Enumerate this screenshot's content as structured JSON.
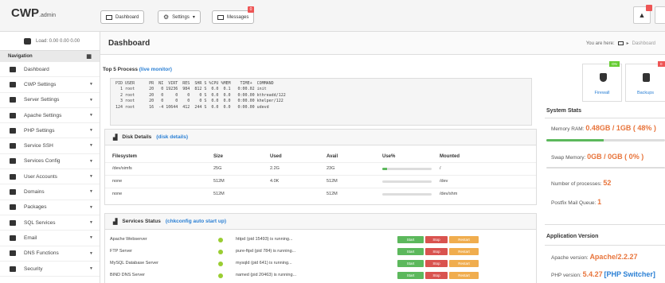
{
  "topbar": {
    "brand": "CWP",
    "brand_suffix": ".admin",
    "dashboard_btn": "Dashboard",
    "settings_btn": "Settings",
    "messages_btn": "Messages",
    "messages_badge": "0"
  },
  "sidebar": {
    "load": "Load: 0.00 0.00 0.00",
    "nav_title": "Navigation",
    "items": [
      {
        "label": "Dashboard",
        "icon": "home-icon",
        "arrow": ""
      },
      {
        "label": "CWP Settings",
        "icon": "wrench-icon",
        "arrow": "▼"
      },
      {
        "label": "Server Settings",
        "icon": "server-icon",
        "arrow": "▼"
      },
      {
        "label": "Apache Settings",
        "icon": "feather-icon",
        "arrow": "▼"
      },
      {
        "label": "PHP Settings",
        "icon": "gear-icon",
        "arrow": "▼"
      },
      {
        "label": "Service SSH",
        "icon": "monitor-icon",
        "arrow": "▼"
      },
      {
        "label": "Services Config",
        "icon": "list-icon",
        "arrow": "▼"
      },
      {
        "label": "User Accounts",
        "icon": "user-icon",
        "arrow": "▼"
      },
      {
        "label": "Domains",
        "icon": "globe-icon",
        "arrow": "▼"
      },
      {
        "label": "Packages",
        "icon": "package-icon",
        "arrow": "▼"
      },
      {
        "label": "SQL Services",
        "icon": "database-icon",
        "arrow": "▼"
      },
      {
        "label": "Email",
        "icon": "envelope-icon",
        "arrow": "▼"
      },
      {
        "label": "DNS Functions",
        "icon": "dns-icon",
        "arrow": "▼"
      },
      {
        "label": "Security",
        "icon": "shield-icon",
        "arrow": "▼"
      }
    ]
  },
  "page": {
    "title": "Dashboard",
    "breadcrumb_prefix": "You are here:",
    "breadcrumb_current": "Dashboard"
  },
  "top5": {
    "title": "Top 5 Process",
    "link": "(live monitor)",
    "lines": [
      "PID USER      PR  NI  VIRT  RES  SHR S %CPU %MEM    TIME+  COMMAND",
      "  1 root      20   0 19236  984  812 S  0.0  0.1   0:00.02 init",
      "  2 root      20   0     0    0    0 S  0.0  0.0   0:00.00 kthreadd/122",
      "  3 root      20   0     0    0    0 S  0.0  0.0   0:00.00 khelper/122",
      "124 root      16  -4 10644  412  244 S  0.0  0.0   0:00.00 udevd"
    ]
  },
  "disk": {
    "title": "Disk Details",
    "link": "(disk details)",
    "headers": [
      "Filesystem",
      "Size",
      "Used",
      "Avail",
      "Use%",
      "Mounted"
    ],
    "rows": [
      {
        "fs": "/dev/simfs",
        "size": "25G",
        "used": "2.2G",
        "avail": "23G",
        "use_frac": 0.09,
        "mount": "/"
      },
      {
        "fs": "none",
        "size": "512M",
        "used": "4.0K",
        "avail": "512M",
        "use_frac": 0.0,
        "mount": "/dev"
      },
      {
        "fs": "none",
        "size": "512M",
        "used": "",
        "avail": "512M",
        "use_frac": 0.0,
        "mount": "/dev/shm"
      }
    ]
  },
  "services": {
    "title": "Services Status",
    "link": "(chkconfig auto start up)",
    "start_label": "Start",
    "stop_label": "Stop",
    "restart_label": "Restart",
    "rows": [
      {
        "name": "Apache Webserver",
        "status": "httpd (pid 15493) is running..."
      },
      {
        "name": "FTP Server",
        "status": "pure-ftpd (pid 784) is running..."
      },
      {
        "name": "MySQL Database Server",
        "status": "mysqld (pid 641) is running..."
      },
      {
        "name": "BIND DNS Server",
        "status": "named (pid 20463) is running..."
      }
    ]
  },
  "right": {
    "firewall_label": "Firewall",
    "firewall_badge": "ON",
    "backups_label": "Backups",
    "backups_badge": "0",
    "system_stats": "System Stats",
    "memory_label": "Memory RAM:",
    "memory_value": "0.48GB / 1GB ( 48% )",
    "memory_frac": 0.48,
    "swap_label": "Swap Memory:",
    "swap_value": "0GB / 0GB ( 0% )",
    "swap_frac": 0.0,
    "processes_label": "Number of processes:",
    "processes_value": "52",
    "postfix_label": "Postfix Mail Queue:",
    "postfix_value": "1",
    "app_version": "Application Version",
    "apache_label": "Apache version:",
    "apache_value": "Apache/2.2.27",
    "php_label": "PHP version:",
    "php_value": "5.4.27",
    "php_switcher": "[PHP Switcher]"
  },
  "colors": {
    "accent_link": "#2a7fd4",
    "value_orange": "#e8743b",
    "start_green": "#5cb85c",
    "stop_red": "#d9534f",
    "restart_orange": "#f0ad4e"
  }
}
